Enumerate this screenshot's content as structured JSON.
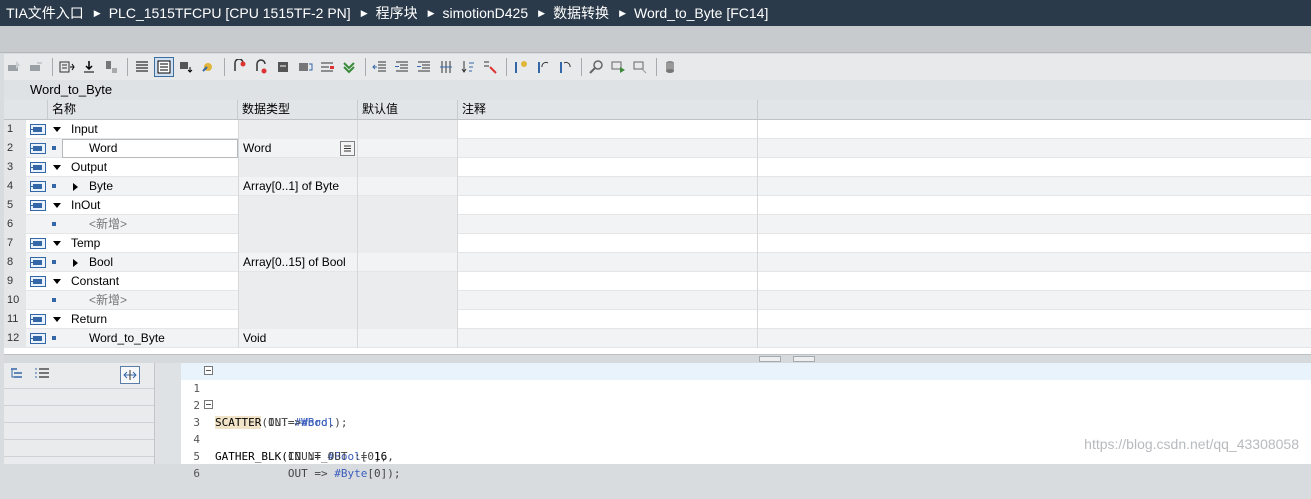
{
  "breadcrumb": [
    "TIA文件入口",
    "PLC_1515TFCPU [CPU 1515TF-2 PN]",
    "程序块",
    "simotionD425",
    "数据转换",
    "Word_to_Byte [FC14]"
  ],
  "block_title": "Word_to_Byte",
  "columns": {
    "name": "名称",
    "type": "数据类型",
    "default": "默认值",
    "comment": "注释"
  },
  "rows": [
    {
      "num": "1",
      "kind": "section",
      "name": "Input",
      "type": ""
    },
    {
      "num": "2",
      "kind": "var",
      "name": "Word",
      "type": "Word",
      "editing": true
    },
    {
      "num": "3",
      "kind": "section",
      "name": "Output",
      "type": ""
    },
    {
      "num": "4",
      "kind": "array",
      "name": "Byte",
      "type": "Array[0..1] of Byte"
    },
    {
      "num": "5",
      "kind": "section",
      "name": "InOut",
      "type": ""
    },
    {
      "num": "6",
      "kind": "new",
      "name": "<新增>",
      "type": ""
    },
    {
      "num": "7",
      "kind": "section",
      "name": "Temp",
      "type": ""
    },
    {
      "num": "8",
      "kind": "array",
      "name": "Bool",
      "type": "Array[0..15] of Bool"
    },
    {
      "num": "9",
      "kind": "section",
      "name": "Constant",
      "type": ""
    },
    {
      "num": "10",
      "kind": "new",
      "name": "<新增>",
      "type": ""
    },
    {
      "num": "11",
      "kind": "section",
      "name": "Return",
      "type": ""
    },
    {
      "num": "12",
      "kind": "var",
      "name": "Word_to_Byte",
      "type": "Void"
    }
  ],
  "code": {
    "l1_num": "1",
    "l1_kw": "SCATTER",
    "l1_rest_a": "(IN:=",
    "l1_var": "#Word",
    "l1_rest_b": ",",
    "l2_num": "2",
    "l2_a": "        OUT=>",
    "l2_var": "#Bool",
    "l2_b": ");",
    "l3_num": "3",
    "l3_a": "GATHER_BLK(IN := ",
    "l3_var": "#Bool",
    "l3_b": "[0],",
    "l4_num": "4",
    "l4_a": "           COUNT_OUT := ",
    "l4_num_val": "16",
    "l4_b": ",",
    "l5_num": "5",
    "l5_a": "           OUT => ",
    "l5_var": "#Byte",
    "l5_b": "[0]);",
    "l6_num": "6"
  },
  "watermark": "https://blog.csdn.net/qq_43308058",
  "colors": {
    "title_bg": "#2b3a4a",
    "accent": "#3467a8"
  }
}
